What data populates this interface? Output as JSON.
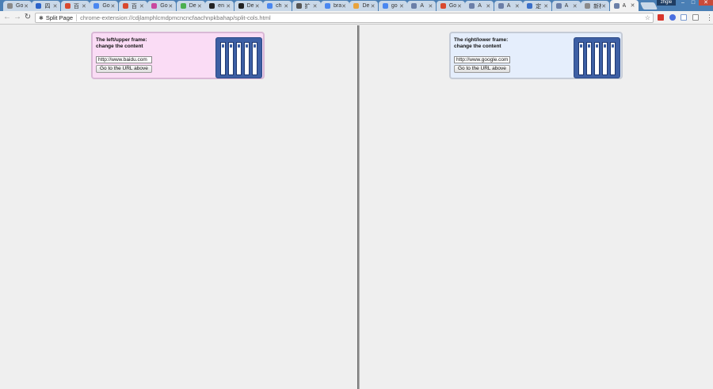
{
  "browser": {
    "tabs": [
      {
        "label": "Go",
        "favicon_color": "#8a8a8a"
      },
      {
        "label": "四",
        "favicon_color": "#2a62c9"
      },
      {
        "label": "百",
        "favicon_color": "#d9492f"
      },
      {
        "label": "Go",
        "favicon_color": "#4a87f0"
      },
      {
        "label": "百",
        "favicon_color": "#d9492f"
      },
      {
        "label": "Go",
        "favicon_color": "#c9489f"
      },
      {
        "label": "De",
        "favicon_color": "#4caf50"
      },
      {
        "label": "en",
        "favicon_color": "#222222"
      },
      {
        "label": "De",
        "favicon_color": "#222222"
      },
      {
        "label": "ch",
        "favicon_color": "#4a87f0"
      },
      {
        "label": "扩",
        "favicon_color": "#555555"
      },
      {
        "label": "bra",
        "favicon_color": "#4a87f0"
      },
      {
        "label": "De",
        "favicon_color": "#e8a33d"
      },
      {
        "label": "go",
        "favicon_color": "#4a87f0"
      },
      {
        "label": "A",
        "favicon_color": "#6b7fa8"
      },
      {
        "label": "Go",
        "favicon_color": "#d9492f"
      },
      {
        "label": "A",
        "favicon_color": "#6b7fa8"
      },
      {
        "label": "A",
        "favicon_color": "#6b7fa8"
      },
      {
        "label": "定",
        "favicon_color": "#3a6fc9"
      },
      {
        "label": "A",
        "favicon_color": "#6b7fa8"
      },
      {
        "label": "新标签",
        "favicon_color": "#8a8a8a"
      },
      {
        "label": "A",
        "favicon_color": "#6b7fa8",
        "active": true
      }
    ],
    "close_glyph": "✕",
    "user_name": "zhgle",
    "window_controls": {
      "minimize": "–",
      "maximize": "□",
      "close": "✕"
    },
    "nav": {
      "back_icon": "←",
      "forward_icon": "→",
      "reload_icon": "↻"
    },
    "omnibox": {
      "origin_label": "Split Page",
      "url": "chrome-extension://cdjlamphlcmdpmcncncfaachnpkbahap/split-cols.html",
      "star_icon": "☆"
    },
    "extensions": [
      {
        "name": "ext-red",
        "color": "#d9362b"
      },
      {
        "name": "ext-blue-circle",
        "color": "#4a6fe0"
      },
      {
        "name": "ext-window",
        "color": "#7a9ad0"
      },
      {
        "name": "ext-grid",
        "color": "#8c8c8c"
      }
    ],
    "menu_icon": "⋮"
  },
  "left_frame": {
    "title_line1": "The left/upper frame:",
    "title_line2": "change the content",
    "url_value": "http://www.baidu.com",
    "button_label": "Go to the URL above",
    "background_color": "#fadcf5"
  },
  "right_frame": {
    "title_line1": "The right/lower frame:",
    "title_line2": "change the content",
    "url_value": "http://www.google.com",
    "button_label": "Go to the URL above",
    "background_color": "#e5eefc"
  }
}
